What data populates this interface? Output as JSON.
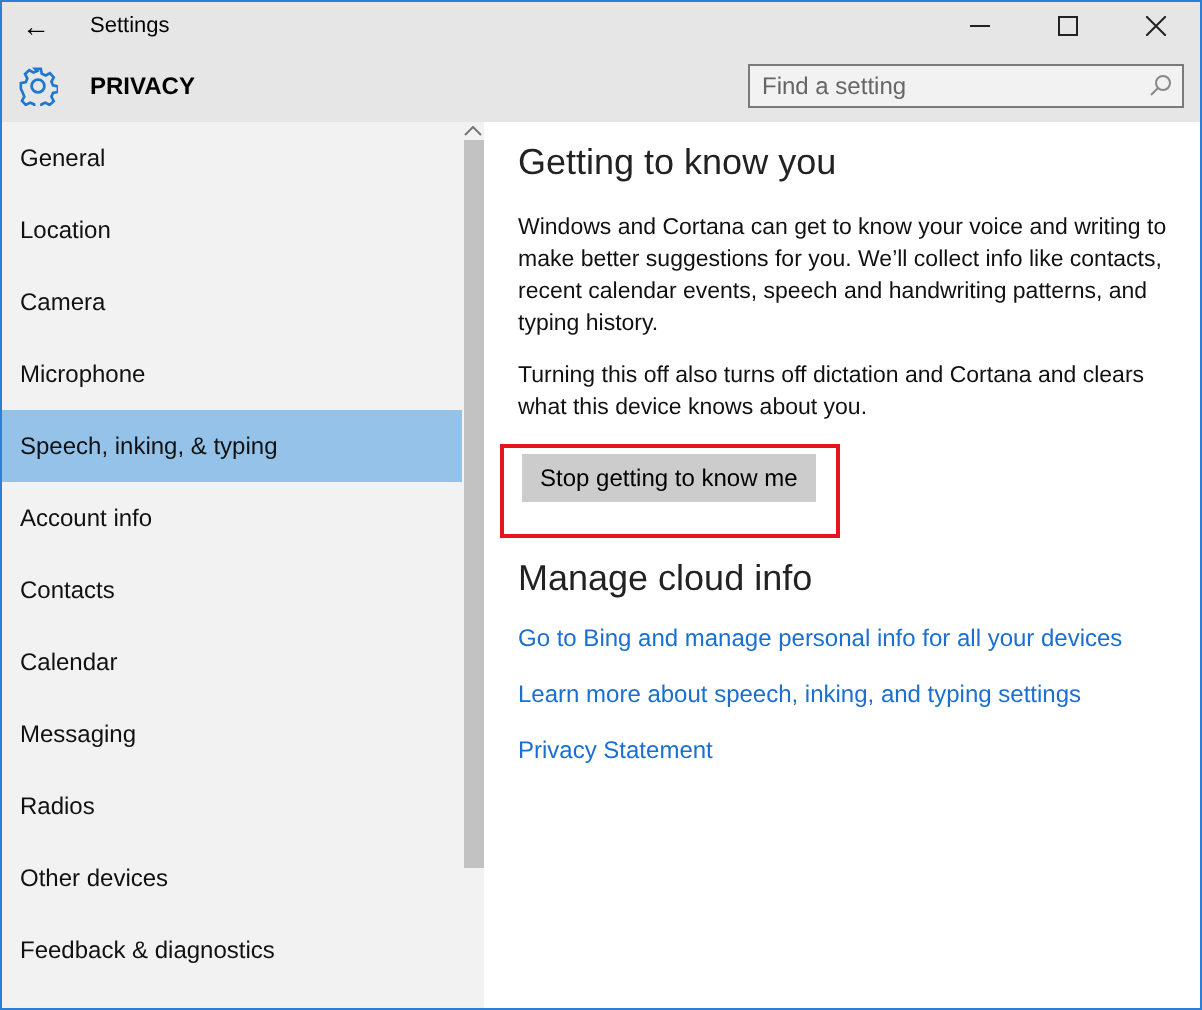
{
  "window": {
    "title": "Settings",
    "back": "←"
  },
  "header": {
    "title": "PRIVACY",
    "search": {
      "placeholder": "Find a setting"
    }
  },
  "sidebar": {
    "items": [
      {
        "label": "General",
        "selected": false
      },
      {
        "label": "Location",
        "selected": false
      },
      {
        "label": "Camera",
        "selected": false
      },
      {
        "label": "Microphone",
        "selected": false
      },
      {
        "label": "Speech, inking, & typing",
        "selected": true
      },
      {
        "label": "Account info",
        "selected": false
      },
      {
        "label": "Contacts",
        "selected": false
      },
      {
        "label": "Calendar",
        "selected": false
      },
      {
        "label": "Messaging",
        "selected": false
      },
      {
        "label": "Radios",
        "selected": false
      },
      {
        "label": "Other devices",
        "selected": false
      },
      {
        "label": "Feedback & diagnostics",
        "selected": false
      }
    ]
  },
  "content": {
    "heading": "Getting to know you",
    "paragraphs": [
      "Windows and Cortana can get to know your voice and writing to make better suggestions for you. We’ll collect info like contacts, recent calendar events, speech and handwriting patterns, and typing history.",
      "Turning this off also turns off dictation and Cortana and clears what this device knows about you."
    ],
    "button": {
      "label": "Stop getting to know me",
      "highlighted": true
    },
    "heading2": "Manage cloud info",
    "links": [
      "Go to Bing and manage personal info for all your devices",
      "Learn more about speech, inking, and typing settings",
      "Privacy Statement"
    ]
  }
}
